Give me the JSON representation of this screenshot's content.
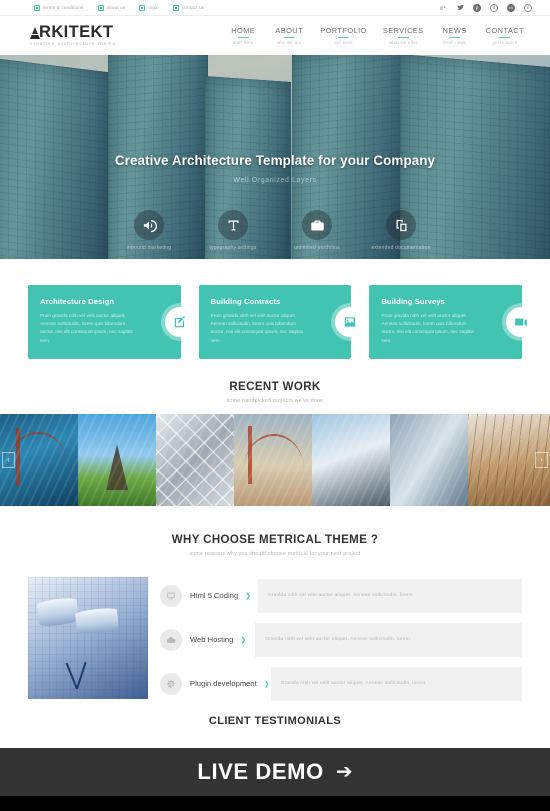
{
  "topbar": {
    "links": [
      {
        "label": "terms & conditions",
        "icon": "square-link-icon"
      },
      {
        "label": "about us",
        "icon": "square-link-icon"
      },
      {
        "label": "login",
        "icon": "square-link-icon"
      },
      {
        "label": "contact us",
        "icon": "square-link-icon"
      }
    ],
    "social": [
      {
        "name": "google-plus-icon",
        "glyph": "g+"
      },
      {
        "name": "twitter-icon",
        "glyph": "t"
      },
      {
        "name": "pinterest-icon",
        "glyph": "p"
      },
      {
        "name": "dribbble-icon",
        "glyph": "d"
      },
      {
        "name": "linkedin-icon",
        "glyph": "in"
      },
      {
        "name": "facebook-icon",
        "glyph": "f"
      }
    ]
  },
  "header": {
    "logo": "RKITEKT",
    "logo_full": "ARKITEKT",
    "tagline": "creative architecture theme",
    "nav": [
      {
        "label": "HOME",
        "sub": "start here"
      },
      {
        "label": "ABOUT",
        "sub": "who we are"
      },
      {
        "label": "PORTFOLIO",
        "sub": "our work"
      },
      {
        "label": "SERVICES",
        "sub": "what we offer"
      },
      {
        "label": "NEWS",
        "sub": "fresh news"
      },
      {
        "label": "CONTACT",
        "sub": "get in touch"
      }
    ]
  },
  "hero": {
    "title": "Creative Architecture Template for your Company",
    "subtitle": "Well Organized Layers",
    "features": [
      {
        "icon": "megaphone-icon",
        "label": "inbound marketing"
      },
      {
        "icon": "typography-icon",
        "label": "typography settings"
      },
      {
        "icon": "briefcase-icon",
        "label": "unlimited portfolios"
      },
      {
        "icon": "layers-icon",
        "label": "extended documentation"
      }
    ]
  },
  "services": [
    {
      "title": "Architecture Design",
      "text": "Proin gravida nibh vel velit auctor aliquet. Aenean sollicitudin, lorem quis bibendum auctor, nisi elit consequat ipsum, nec sagittis sem.",
      "icon": "pencil-edit-icon"
    },
    {
      "title": "Building Contracts",
      "text": "Proin gravida nibh vel velit auctor aliquet. Aenean sollicitudin, lorem quis bibendum auctor, nisi elit consequat ipsum, nec sagittis sem.",
      "icon": "image-icon"
    },
    {
      "title": "Building Surveys",
      "text": "Proin gravida nibh vel velit auctor aliquet. Aenean sollicitudin, lorem quis bibendum auctor, nisi elit consequat ipsum, nec sagittis sem.",
      "icon": "video-camera-icon"
    }
  ],
  "recent_work": {
    "title": "RECENT WORK",
    "subtitle": "some handpicked projects we've done",
    "prev_label": "‹",
    "next_label": "›",
    "slides": [
      {
        "name": "bridge-photo"
      },
      {
        "name": "eiffel-tower-photo"
      },
      {
        "name": "facade-pattern-photo"
      },
      {
        "name": "golden-gate-photo"
      },
      {
        "name": "office-building-photo"
      },
      {
        "name": "glass-facade-photo"
      },
      {
        "name": "wood-floor-photo"
      }
    ]
  },
  "why_choose": {
    "title": "WHY CHOOSE METRICAL THEME ?",
    "subtitle": "some reasons why you should choose metrical for your next project",
    "image_name": "blueprint-photo",
    "features": [
      {
        "label": "Html 5 Coding",
        "icon": "monitor-icon",
        "arrow": "❯",
        "text": "Gravida nibh vel velit auctor aliquet. Aenean sollicitudin, lorem"
      },
      {
        "label": "Web Hosting",
        "icon": "cloud-icon",
        "arrow": "❯",
        "text": "Gravida nibh vel velit auctor aliquet. Aenean sollicitudin, lorem"
      },
      {
        "label": "Plugin development",
        "icon": "gear-icon",
        "arrow": "❯",
        "text": "Gravida nibh vel velit auctor aliquet. Aenean sollicitudin, lorem"
      }
    ]
  },
  "testimonials": {
    "title": "CLIENT TESTIMONIALS"
  },
  "live_demo": {
    "label": "LIVE DEMO",
    "arrow": "➔"
  },
  "colors": {
    "accent": "#43c3b2",
    "dark_bar": "#333333",
    "heading": "#333333",
    "muted": "#b5b5b5"
  }
}
